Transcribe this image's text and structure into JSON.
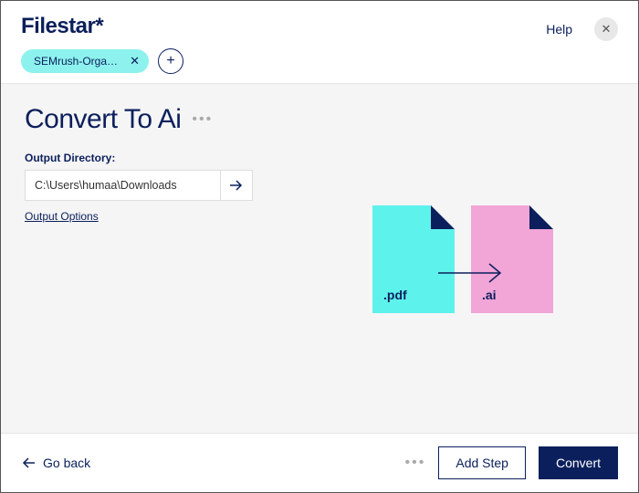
{
  "header": {
    "logo": "Filestar*",
    "chip": {
      "label": "SEMrush-Organic..."
    },
    "help": "Help"
  },
  "main": {
    "title": "Convert To Ai",
    "output_dir_label": "Output Directory:",
    "output_dir_value": "C:\\Users\\humaa\\Downloads",
    "output_options": "Output Options",
    "src_ext": ".pdf",
    "dst_ext": ".ai"
  },
  "footer": {
    "goback": "Go back",
    "add_step": "Add Step",
    "convert": "Convert"
  }
}
